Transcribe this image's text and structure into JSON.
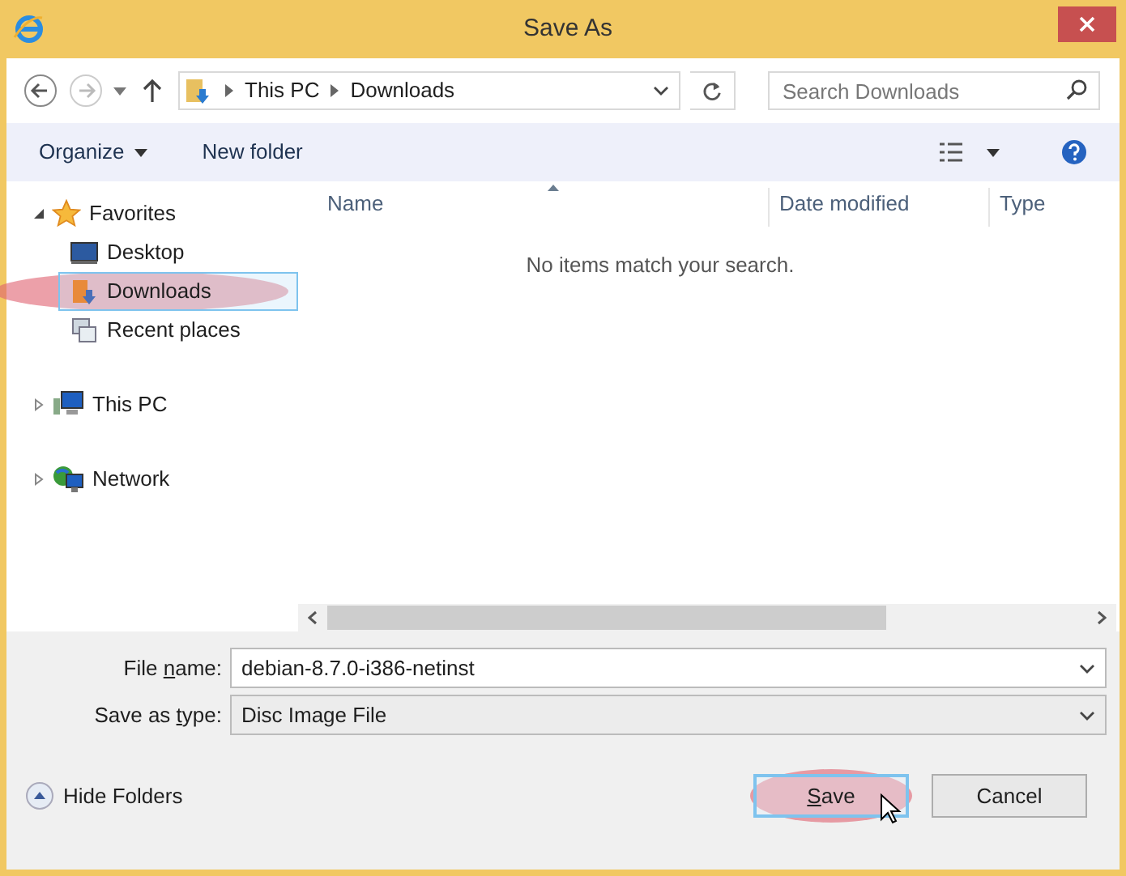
{
  "window": {
    "title": "Save As"
  },
  "nav": {
    "breadcrumb": [
      "This PC",
      "Downloads"
    ],
    "search": {
      "placeholder": "Search Downloads"
    }
  },
  "toolbar": {
    "organize": "Organize",
    "new_folder": "New folder"
  },
  "sidebar": {
    "items": [
      {
        "label": "Favorites",
        "kind": "favorites",
        "expanded": true,
        "selected": false,
        "annotated": false,
        "children": [
          {
            "label": "Desktop",
            "kind": "desktop",
            "selected": false,
            "annotated": false
          },
          {
            "label": "Downloads",
            "kind": "downloads",
            "selected": true,
            "annotated": true
          },
          {
            "label": "Recent places",
            "kind": "recent",
            "selected": false,
            "annotated": false
          }
        ]
      },
      {
        "label": "This PC",
        "kind": "pc",
        "expanded": false,
        "selected": false,
        "annotated": false
      },
      {
        "label": "Network",
        "kind": "network",
        "expanded": false,
        "selected": false,
        "annotated": false
      }
    ]
  },
  "file_list": {
    "columns": [
      "Name",
      "Date modified",
      "Type"
    ],
    "empty_message": "No items match your search."
  },
  "fields": [
    {
      "label": {
        "before": "File ",
        "key": "n",
        "after": "ame:"
      },
      "value": "debian-8.7.0-i386-netinst",
      "kind": "editable"
    },
    {
      "label": {
        "before": "Save as ",
        "key": "t",
        "after": "ype:"
      },
      "value": "Disc Image File",
      "kind": "select"
    }
  ],
  "hide_folders": "Hide Folders",
  "buttons": [
    {
      "label": {
        "key": "S",
        "after": "ave"
      },
      "default": true,
      "annotated": true
    },
    {
      "label": {
        "before": "Cancel"
      },
      "default": false,
      "annotated": false
    }
  ]
}
